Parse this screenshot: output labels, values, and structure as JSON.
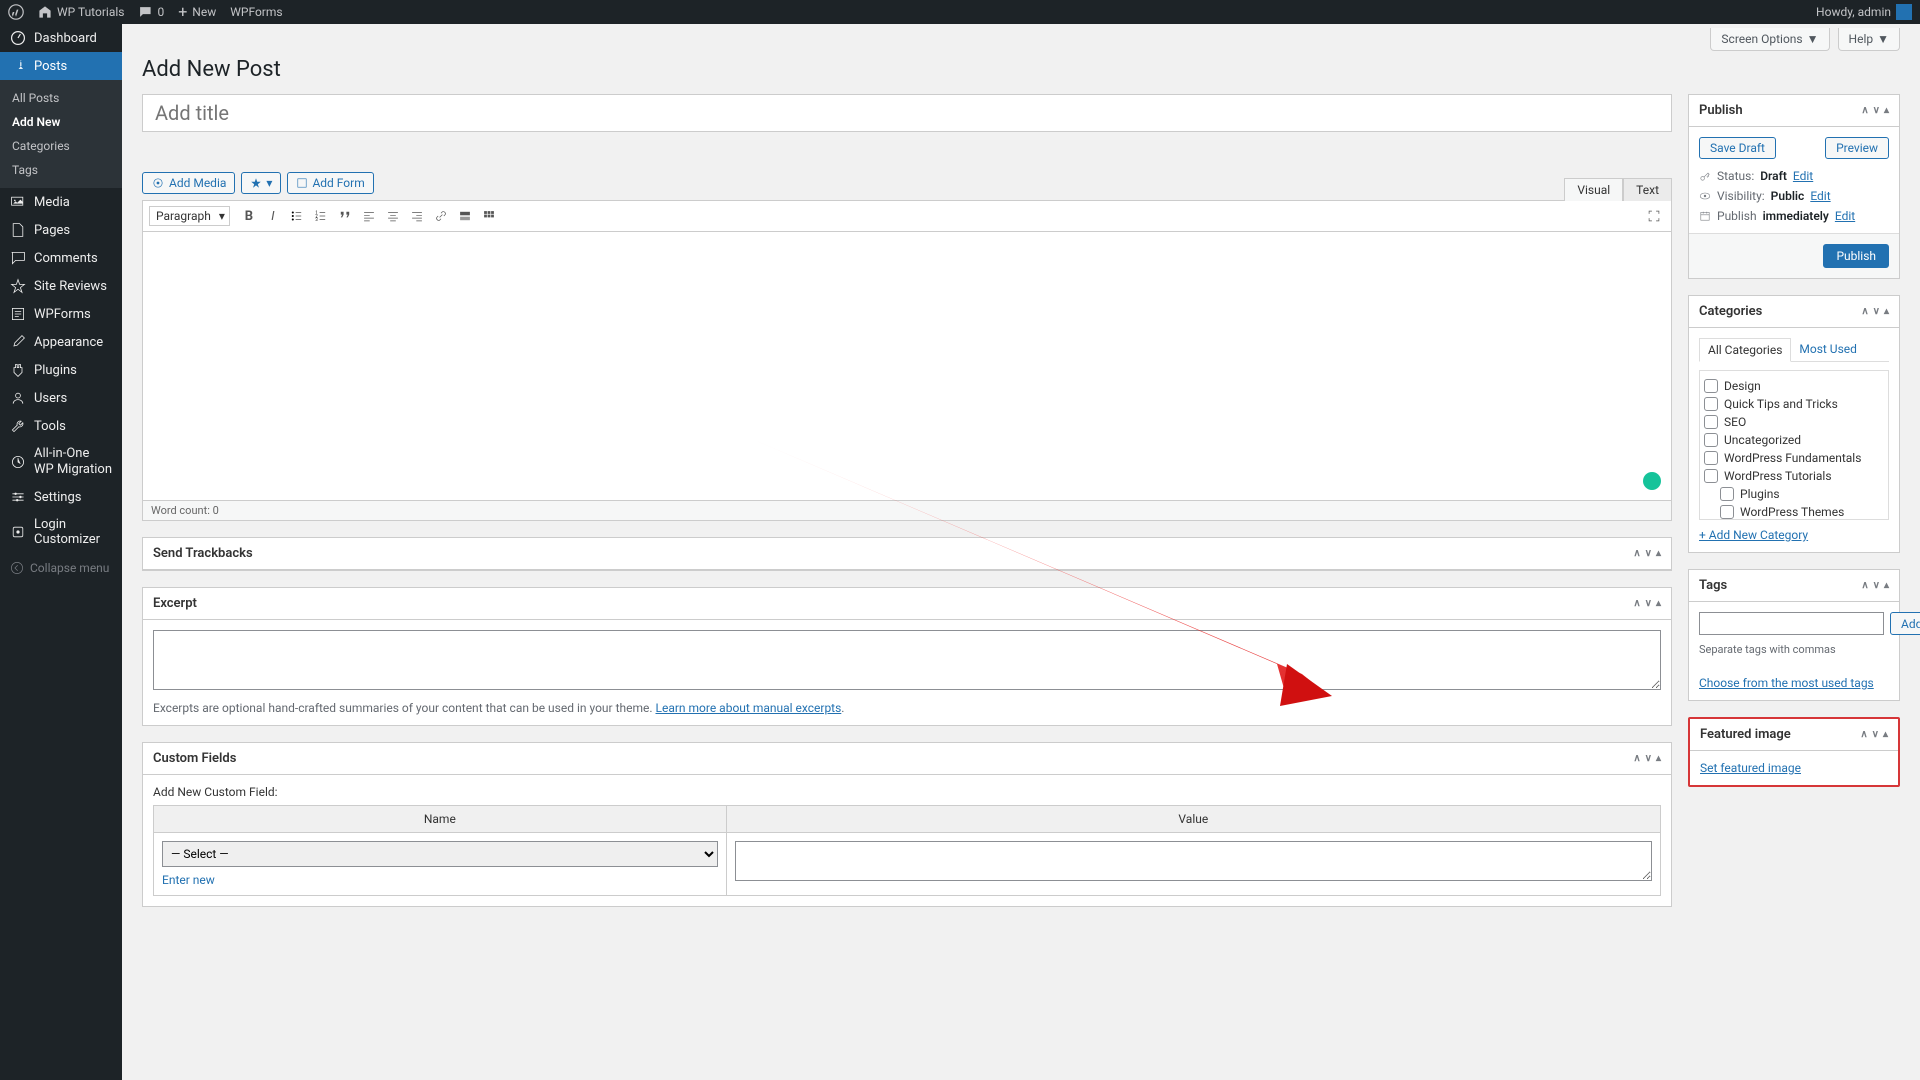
{
  "adminbar": {
    "site_title": "WP Tutorials",
    "comments": "0",
    "new": "New",
    "wpforms": "WPForms",
    "howdy": "Howdy, admin"
  },
  "sidebar": {
    "dashboard": "Dashboard",
    "posts": "Posts",
    "posts_sub": {
      "all": "All Posts",
      "add": "Add New",
      "categories": "Categories",
      "tags": "Tags"
    },
    "media": "Media",
    "pages": "Pages",
    "comments": "Comments",
    "site_reviews": "Site Reviews",
    "wpforms": "WPForms",
    "appearance": "Appearance",
    "plugins": "Plugins",
    "users": "Users",
    "tools": "Tools",
    "aio": "All-in-One WP Migration",
    "settings": "Settings",
    "login_customizer": "Login Customizer",
    "collapse": "Collapse menu"
  },
  "header": {
    "title": "Add New Post",
    "screen_options": "Screen Options",
    "help": "Help"
  },
  "editor": {
    "title_placeholder": "Add title",
    "add_media": "Add Media",
    "add_form": "Add Form",
    "visual": "Visual",
    "text": "Text",
    "paragraph": "Paragraph",
    "word_count": "Word count: 0"
  },
  "trackbacks": {
    "title": "Send Trackbacks"
  },
  "excerpt": {
    "title": "Excerpt",
    "note_pre": "Excerpts are optional hand-crafted summaries of your content that can be used in your theme. ",
    "note_link": "Learn more about manual excerpts"
  },
  "custom_fields": {
    "title": "Custom Fields",
    "add_new": "Add New Custom Field:",
    "name_col": "Name",
    "value_col": "Value",
    "select_placeholder": "— Select —",
    "enter_new": "Enter new"
  },
  "publish": {
    "title": "Publish",
    "save_draft": "Save Draft",
    "preview": "Preview",
    "status_label": "Status:",
    "status_value": "Draft",
    "visibility_label": "Visibility:",
    "visibility_value": "Public",
    "publish_label": "Publish",
    "publish_value": "immediately",
    "edit": "Edit",
    "publish_btn": "Publish"
  },
  "categories": {
    "title": "Categories",
    "all_tab": "All Categories",
    "most_used": "Most Used",
    "items": [
      "Design",
      "Quick Tips and Tricks",
      "SEO",
      "Uncategorized",
      "WordPress Fundamentals",
      "WordPress Tutorials"
    ],
    "sub_items": [
      "Plugins",
      "WordPress Themes"
    ],
    "add_new": "+ Add New Category"
  },
  "tags": {
    "title": "Tags",
    "add": "Add",
    "separate": "Separate tags with commas",
    "choose": "Choose from the most used tags"
  },
  "featured": {
    "title": "Featured image",
    "set": "Set featured image"
  }
}
